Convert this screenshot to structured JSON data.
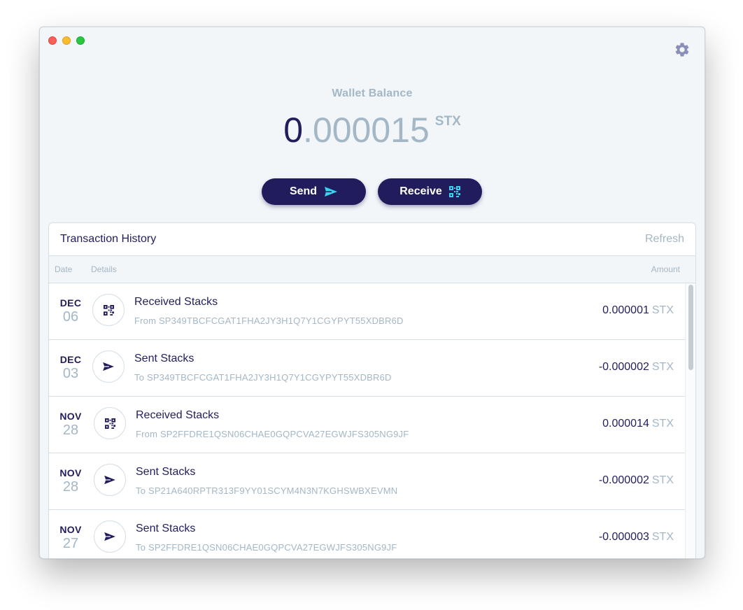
{
  "window": {
    "controls": [
      "close",
      "minimize",
      "zoom"
    ]
  },
  "header": {
    "settings_icon": "gear-icon"
  },
  "balance": {
    "label": "Wallet Balance",
    "whole": "0",
    "fraction": ".000015",
    "unit": "STX"
  },
  "actions": {
    "send_label": "Send",
    "receive_label": "Receive",
    "send_icon": "paper-plane-icon",
    "receive_icon": "qr-code-icon"
  },
  "history": {
    "title": "Transaction History",
    "refresh_label": "Refresh",
    "columns": {
      "date": "Date",
      "details": "Details",
      "amount": "Amount"
    },
    "transactions": [
      {
        "month": "DEC",
        "day": "06",
        "type": "received",
        "title": "Received Stacks",
        "address": "From SP349TBCFCGAT1FHA2JY3H1Q7Y1CGYPYT55XDBR6D",
        "amount": "0.000001",
        "unit": "STX"
      },
      {
        "month": "DEC",
        "day": "03",
        "type": "sent",
        "title": "Sent Stacks",
        "address": "To SP349TBCFCGAT1FHA2JY3H1Q7Y1CGYPYT55XDBR6D",
        "amount": "-0.000002",
        "unit": "STX"
      },
      {
        "month": "NOV",
        "day": "28",
        "type": "received",
        "title": "Received Stacks",
        "address": "From SP2FFDRE1QSN06CHAE0GQPCVA27EGWJFS305NG9JF",
        "amount": "0.000014",
        "unit": "STX"
      },
      {
        "month": "NOV",
        "day": "28",
        "type": "sent",
        "title": "Sent Stacks",
        "address": "To SP21A640RPTR313F9YY01SCYM4N3N7KGHSWBXEVMN",
        "amount": "-0.000002",
        "unit": "STX"
      },
      {
        "month": "NOV",
        "day": "27",
        "type": "sent",
        "title": "Sent Stacks",
        "address": "To SP2FFDRE1QSN06CHAE0GQPCVA27EGWJFS305NG9JF",
        "amount": "-0.000003",
        "unit": "STX"
      }
    ]
  },
  "colors": {
    "primary": "#211d5d",
    "muted": "#a3b7c6",
    "accent": "#3bd1f0",
    "background": "#f2f6f9"
  }
}
